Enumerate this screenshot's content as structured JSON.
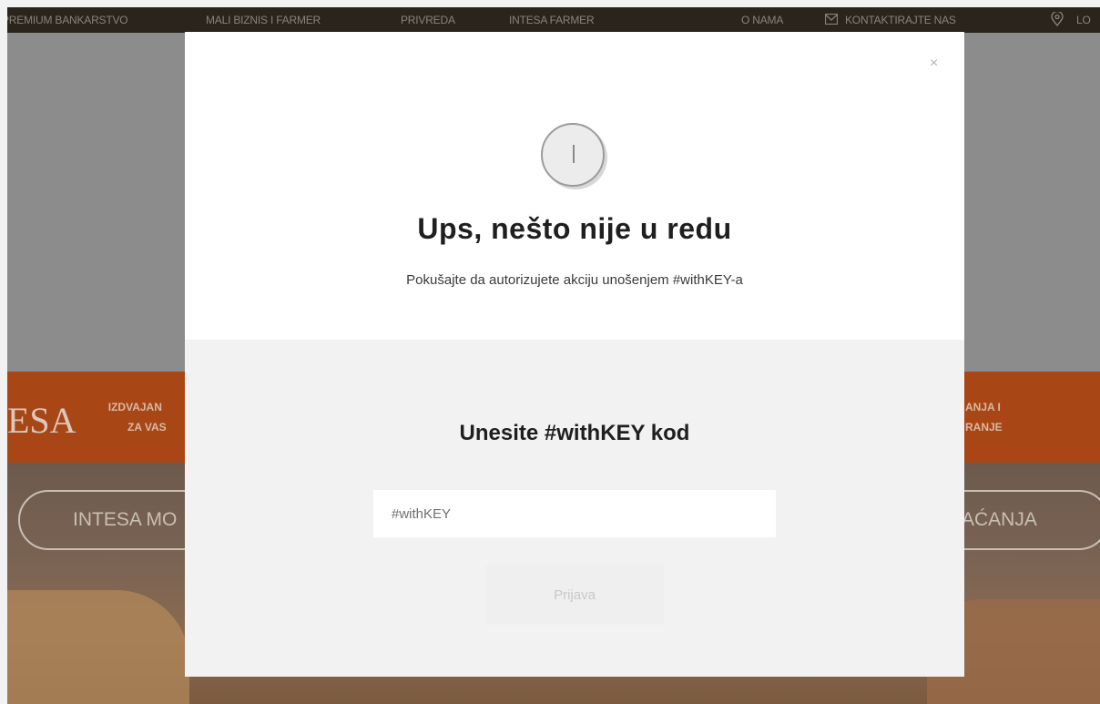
{
  "topnav": {
    "items": [
      "PREMIUM BANKARSTVO",
      "MALI BIZNIS I FARMER",
      "PRIVREDA",
      "INTESA FARMER",
      "O NAMA",
      "KONTAKTIRAJTE NAS",
      "LO"
    ],
    "contact_icon": "envelope-icon",
    "location_icon": "location-pin-icon"
  },
  "orangebar": {
    "logo": "ESA",
    "left_line1": "IZDVAJAN",
    "left_line2": "ZA VAS",
    "right_line1": "ANJA I",
    "right_line2": "RANJE"
  },
  "pills": {
    "left": "INTESA MO",
    "right": "AĆANJA"
  },
  "modal": {
    "close_label": "×",
    "icon": "warning-icon",
    "title": "Ups, nešto nije u redu",
    "message": "Pokušajte da autorizujete akciju unošenjem #withKEY-a",
    "code_title": "Unesite #withKEY kod",
    "input_placeholder": "#withKEY",
    "input_value": "",
    "submit_label": "Prijava"
  },
  "colors": {
    "nav_bg": "#2a241c",
    "orange": "#a84616",
    "modal_bg": "#ffffff",
    "modal_lower_bg": "#f2f2f2"
  }
}
